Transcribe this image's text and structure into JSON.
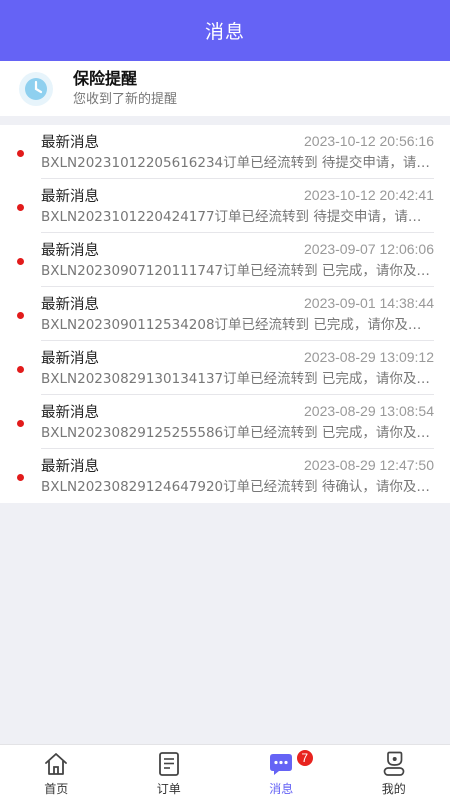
{
  "header": {
    "title": "消息"
  },
  "reminder": {
    "title": "保险提醒",
    "subtitle": "您收到了新的提醒"
  },
  "messages": [
    {
      "title": "最新消息",
      "time": "2023-10-12 20:56:16",
      "body": "BXLN20231012205616234订单已经流转到 待提交申请，请…"
    },
    {
      "title": "最新消息",
      "time": "2023-10-12 20:42:41",
      "body": "BXLN2023101220424177订单已经流转到 待提交申请，请你…"
    },
    {
      "title": "最新消息",
      "time": "2023-09-07 12:06:06",
      "body": "BXLN20230907120111747订单已经流转到 已完成，请你及…"
    },
    {
      "title": "最新消息",
      "time": "2023-09-01 14:38:44",
      "body": "BXLN2023090112534208订单已经流转到 已完成，请你及时…"
    },
    {
      "title": "最新消息",
      "time": "2023-08-29 13:09:12",
      "body": "BXLN20230829130134137订单已经流转到 已完成，请你及…"
    },
    {
      "title": "最新消息",
      "time": "2023-08-29 13:08:54",
      "body": "BXLN20230829125255586订单已经流转到 已完成，请你及…"
    },
    {
      "title": "最新消息",
      "time": "2023-08-29 12:47:50",
      "body": "BXLN20230829124647920订单已经流转到 待确认，请你及…"
    }
  ],
  "tabbar": {
    "home": "首页",
    "orders": "订单",
    "messages": "消息",
    "messages_badge": "7",
    "mine": "我的"
  },
  "colors": {
    "accent": "#6563f5",
    "dot": "#e21b1b",
    "badge": "#e8231f"
  }
}
